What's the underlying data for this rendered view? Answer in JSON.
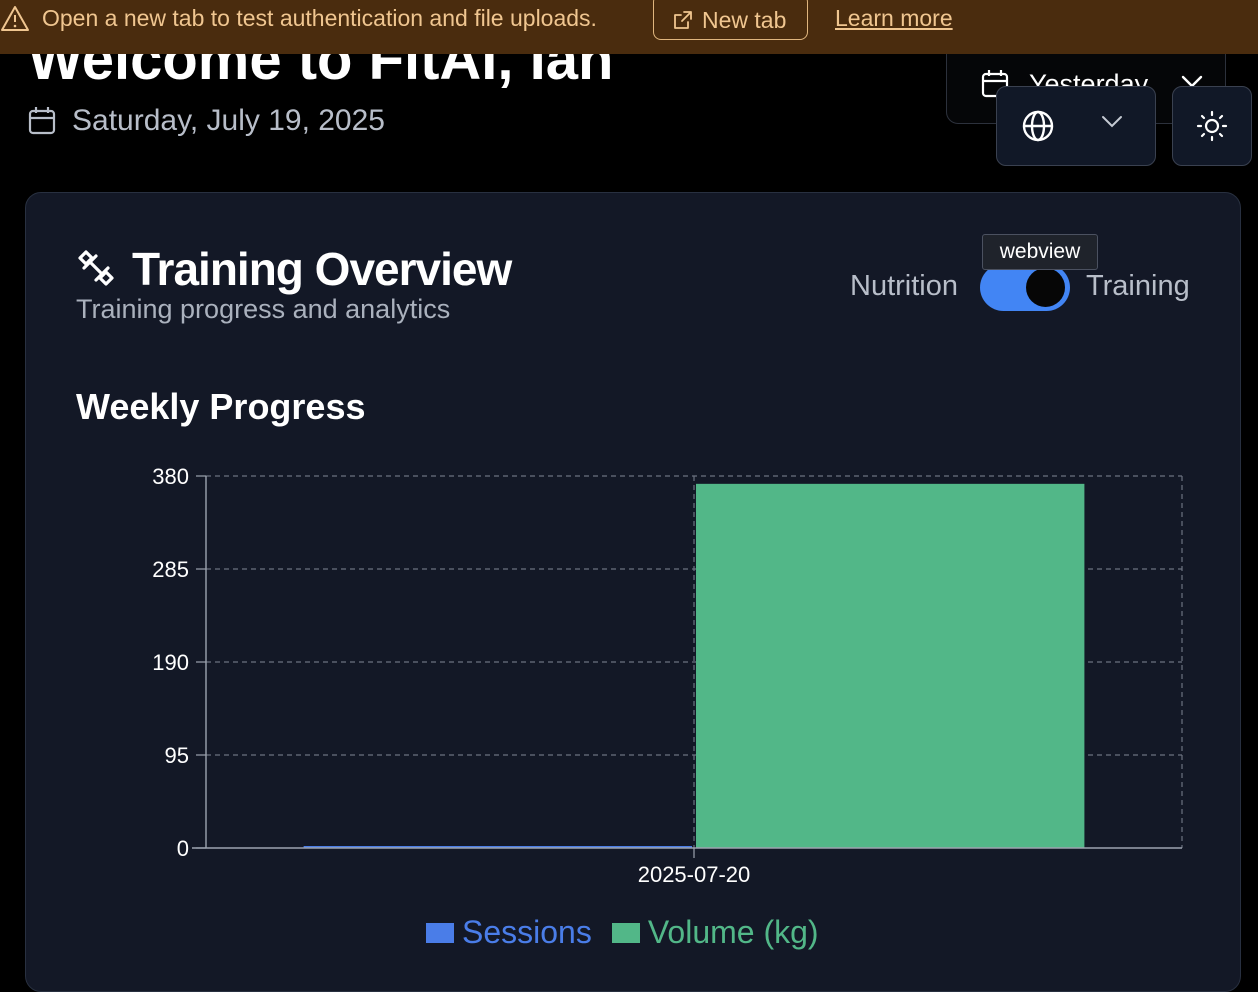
{
  "banner": {
    "message": "Open a new tab to test authentication and file uploads.",
    "new_tab_label": "New tab",
    "learn_more_label": "Learn more"
  },
  "header": {
    "welcome": "Welcome to FitAI, Ian",
    "date": "Saturday, July 19, 2025",
    "date_picker_label": "Yesterday"
  },
  "card": {
    "title": "Training Overview",
    "subtitle": "Training progress and analytics",
    "tooltip": "webview",
    "toggle_left": "Nutrition",
    "toggle_right": "Training",
    "toggle_on": true,
    "section_title": "Weekly Progress"
  },
  "colors": {
    "sessions": "#4a7de8",
    "volume": "#52b788",
    "banner_bg": "#4a2c0e",
    "card_bg": "#131826"
  },
  "chart_data": {
    "type": "bar",
    "categories": [
      "2025-07-20"
    ],
    "series": [
      {
        "name": "Sessions",
        "values": [
          1
        ]
      },
      {
        "name": "Volume (kg)",
        "values": [
          372
        ]
      }
    ],
    "yticks": [
      0,
      95,
      190,
      285,
      380
    ],
    "ylim": [
      0,
      380
    ],
    "grid": true,
    "legend": "bottom-center"
  }
}
